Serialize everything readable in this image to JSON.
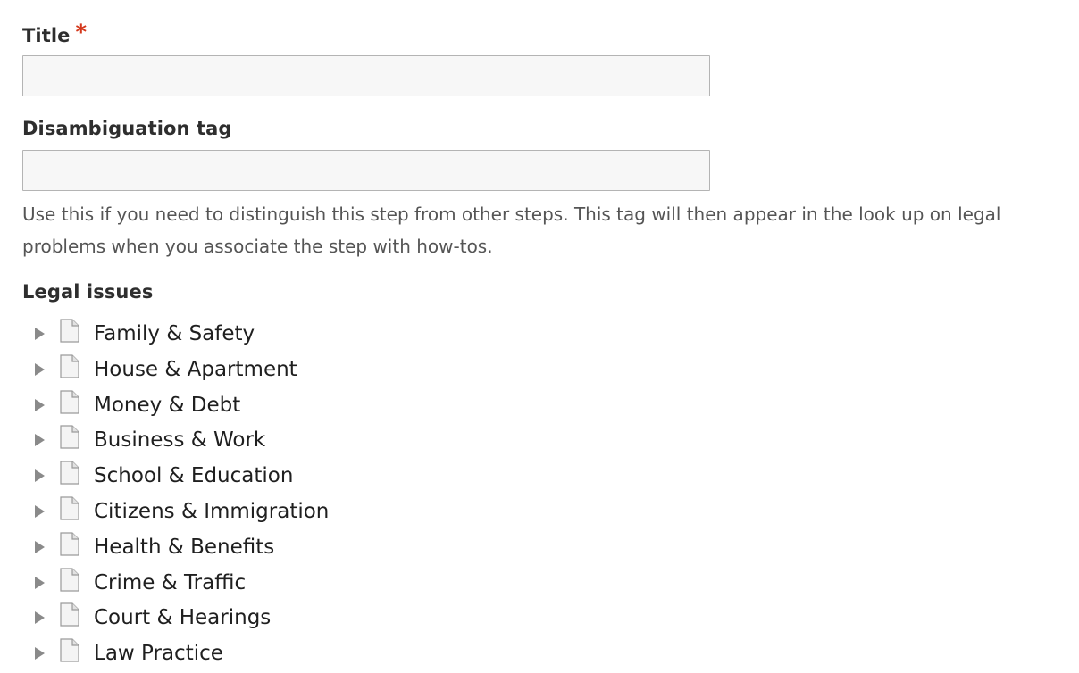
{
  "form": {
    "title_label": "Title",
    "required_marker": "*",
    "title_value": "",
    "disambiguation_label": "Disambiguation tag",
    "disambiguation_value": "",
    "disambiguation_description": "Use this if you need to distinguish this step from other steps. This tag will then appear in the look up on legal problems when you associate the step with how-tos.",
    "legal_issues_label": "Legal issues"
  },
  "legal_issues": [
    {
      "label": "Family & Safety",
      "icon": "file-icon",
      "toggle": "expand-triangle-icon"
    },
    {
      "label": "House & Apartment",
      "icon": "file-icon",
      "toggle": "expand-triangle-icon"
    },
    {
      "label": "Money & Debt",
      "icon": "file-icon",
      "toggle": "expand-triangle-icon"
    },
    {
      "label": "Business & Work",
      "icon": "file-icon",
      "toggle": "expand-triangle-icon"
    },
    {
      "label": "School & Education",
      "icon": "file-icon",
      "toggle": "expand-triangle-icon"
    },
    {
      "label": "Citizens & Immigration",
      "icon": "file-icon",
      "toggle": "expand-triangle-icon"
    },
    {
      "label": "Health & Benefits",
      "icon": "file-icon",
      "toggle": "expand-triangle-icon"
    },
    {
      "label": "Crime & Traffic",
      "icon": "file-icon",
      "toggle": "expand-triangle-icon"
    },
    {
      "label": "Court & Hearings",
      "icon": "file-icon",
      "toggle": "expand-triangle-icon"
    },
    {
      "label": "Law Practice",
      "icon": "file-icon",
      "toggle": "expand-triangle-icon"
    }
  ],
  "colors": {
    "required": "#d4381c",
    "label_text": "#2e2e2e",
    "description_text": "#555555",
    "input_background": "#f7f7f7",
    "input_border": "#b4b4b4",
    "toggle": "#8a8a8a"
  }
}
